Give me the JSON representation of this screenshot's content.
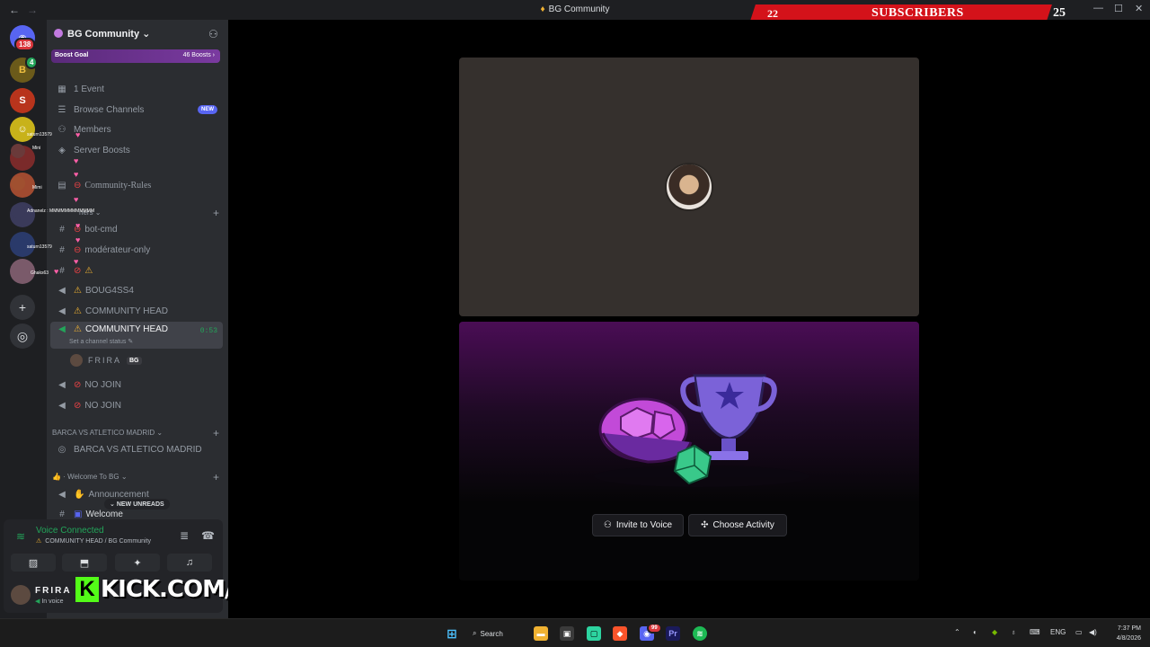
{
  "window": {
    "title": "BG Community",
    "back": "←",
    "forward": "→",
    "minimize": "—",
    "maximize": "☐",
    "close": "✕"
  },
  "subscribers": {
    "count": "22",
    "label": "SUBSCRIBERS",
    "goal": "25"
  },
  "rail": {
    "home_badge": "138",
    "server_badge": "4"
  },
  "server": {
    "name": "BG Community",
    "boost_goal": "Boost Goal",
    "boost_count": "46 Boosts",
    "boost_chevron": "›"
  },
  "nav": {
    "event": "1 Event",
    "browse": "Browse Channels",
    "browse_badge": "NEW",
    "members": "Members",
    "boosts": "Server Boosts"
  },
  "channels": {
    "rules": "Community-Rules",
    "cat_partial": "ners",
    "bot_cmd": "bot-cmd",
    "mod_only": "modérateur-only",
    "boug": "BOUG4SS4",
    "head1": "COMMUNITY HEAD",
    "head2": "COMMUNITY HEAD",
    "head2_timer": "0:53",
    "head2_status": "Set a channel status",
    "voice_user": "FRIRA",
    "voice_user_tag": "BG",
    "nojoin1": "NO JOIN",
    "nojoin2": "NO JOIN",
    "cat_barca": "BARCA VS ATLETICO MADRID",
    "barca_stage": "BARCA VS ATLETICO MADRID",
    "cat_welcome": "Welcome To BG",
    "announcement": "Announcement",
    "welcome": "Welcome",
    "new_unreads": "NEW UNREADS"
  },
  "voice_panel": {
    "status": "Voice Connected",
    "location": "COMMUNITY HEAD / BG Community",
    "user": "FRIRA",
    "user_status": "In voice"
  },
  "overlay": {
    "kick_text": "KICK.COM/FRIRAA",
    "chat": [
      {
        "user": "saturn13579",
        "msg": "♥"
      },
      {
        "user": "Mini",
        "msg": "♥"
      },
      {
        "user": "Mimi",
        "msg": "♥"
      },
      {
        "user": "Adnanelz",
        "msg": "MMMMMMMMMMMM"
      },
      {
        "user": "saturn13579",
        "msg": "♥"
      },
      {
        "user": "Ghaks63",
        "msg": "♥"
      }
    ]
  },
  "stage": {
    "invite": "Invite to Voice",
    "activity": "Choose Activity"
  },
  "taskbar": {
    "search": "Search",
    "discord_badge": "99",
    "lang": "ENG",
    "time": "7:37 PM",
    "date": "4/8/2026"
  },
  "colors": {
    "discord_green": "#23a55a",
    "banner_red": "#d4121a",
    "kick_green": "#53fc18",
    "boost_purple": "#7a3aa0"
  }
}
